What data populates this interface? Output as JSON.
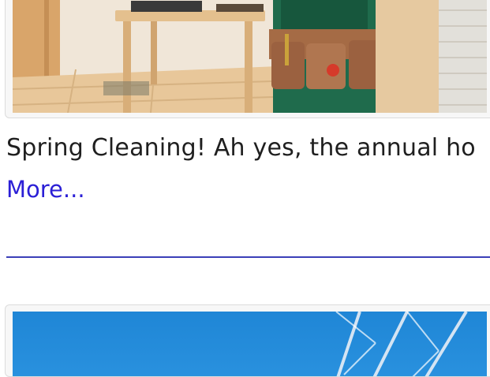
{
  "articles": [
    {
      "image": {
        "alt": "Worker with tool belt in a tiled room with wooden table",
        "palette": {
          "floor": "#e8c79a",
          "wall_left": "#d9a56a",
          "table": "#e4c08e",
          "overalls": "#1f6b4c",
          "toolbelt": "#a56b45",
          "brick_wall": "#e2e0da"
        }
      },
      "excerpt": "Spring Cleaning! Ah yes, the annual ho",
      "more_label": "More..."
    },
    {
      "image": {
        "alt": "Power line tower against blue sky",
        "palette": {
          "sky": "#1f86d6",
          "tower": "#e8eef6"
        }
      }
    }
  ],
  "colors": {
    "link": "#2b1fd6",
    "divider": "#3b3fb8",
    "text": "#1f1f1f"
  }
}
